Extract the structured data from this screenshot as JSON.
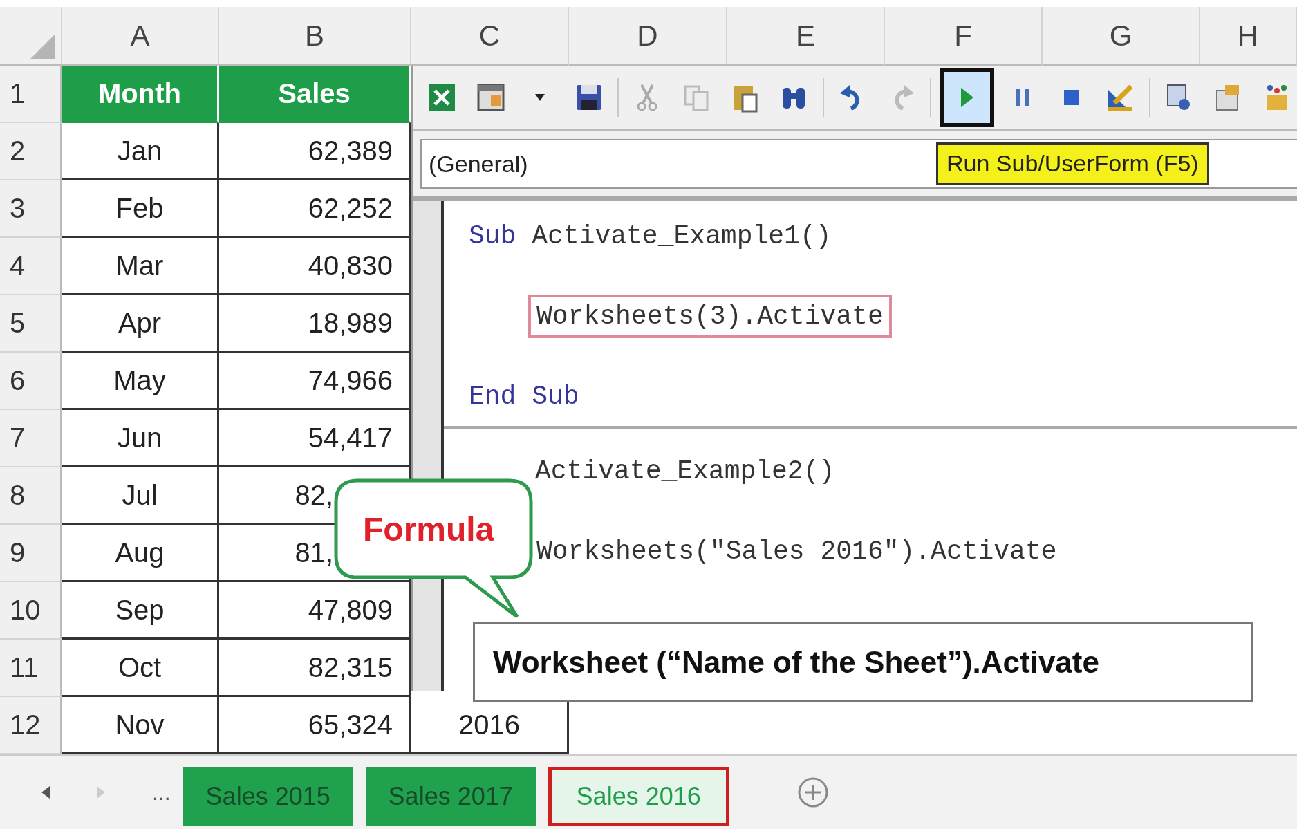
{
  "sheet": {
    "columns": [
      "A",
      "B",
      "C",
      "D",
      "E",
      "F",
      "G",
      "H"
    ],
    "rows": [
      {
        "header": "1",
        "kind": "heading",
        "cells": [
          {
            "text": "Month"
          },
          {
            "text": "Sales"
          }
        ]
      },
      {
        "header": "2",
        "kind": "data",
        "cells": [
          {
            "text": "Jan"
          },
          {
            "text": "62,389"
          }
        ]
      },
      {
        "header": "3",
        "kind": "data",
        "cells": [
          {
            "text": "Feb"
          },
          {
            "text": "62,252"
          }
        ]
      },
      {
        "header": "4",
        "kind": "data",
        "cells": [
          {
            "text": "Mar"
          },
          {
            "text": "40,830"
          }
        ]
      },
      {
        "header": "5",
        "kind": "data",
        "cells": [
          {
            "text": "Apr"
          },
          {
            "text": "18,989"
          }
        ]
      },
      {
        "header": "6",
        "kind": "data",
        "cells": [
          {
            "text": "May"
          },
          {
            "text": "74,966"
          }
        ]
      },
      {
        "header": "7",
        "kind": "data",
        "cells": [
          {
            "text": "Jun"
          },
          {
            "text": "54,417"
          }
        ]
      },
      {
        "header": "8",
        "kind": "data",
        "cells": [
          {
            "text": "Jul"
          },
          {
            "text": "82,",
            "cut": true
          }
        ]
      },
      {
        "header": "9",
        "kind": "data",
        "cells": [
          {
            "text": "Aug"
          },
          {
            "text": "81,",
            "cut": true
          }
        ]
      },
      {
        "header": "10",
        "kind": "data",
        "cells": [
          {
            "text": "Sep"
          },
          {
            "text": "47,809"
          }
        ]
      },
      {
        "header": "11",
        "kind": "data",
        "cells": [
          {
            "text": "Oct"
          },
          {
            "text": "82,315"
          }
        ]
      },
      {
        "header": "12",
        "kind": "data",
        "cells": [
          {
            "text": "Nov"
          },
          {
            "text": "65,324"
          },
          {
            "text": "2016"
          }
        ]
      }
    ],
    "tabs": [
      {
        "label": "Sales 2015",
        "selected": false
      },
      {
        "label": "Sales 2017",
        "selected": false
      },
      {
        "label": "Sales 2016",
        "selected": true
      }
    ],
    "tab_overflow": "..."
  },
  "vba_editor": {
    "toolbar": [
      {
        "kind": "excel",
        "selected": false
      },
      {
        "kind": "insert",
        "selected": false
      },
      {
        "kind": "caret",
        "selected": false
      },
      {
        "kind": "save",
        "selected": false
      },
      {
        "kind": "sep"
      },
      {
        "kind": "cut",
        "selected": false
      },
      {
        "kind": "copy",
        "selected": false
      },
      {
        "kind": "paste",
        "selected": false
      },
      {
        "kind": "find",
        "selected": false
      },
      {
        "kind": "sep"
      },
      {
        "kind": "undo",
        "selected": false
      },
      {
        "kind": "redo",
        "selected": false
      },
      {
        "kind": "sep"
      },
      {
        "kind": "run",
        "selected": true
      },
      {
        "kind": "pause",
        "selected": false
      },
      {
        "kind": "stop",
        "selected": false
      },
      {
        "kind": "design",
        "selected": false
      },
      {
        "kind": "sep"
      },
      {
        "kind": "project",
        "selected": false
      },
      {
        "kind": "properties",
        "selected": false
      },
      {
        "kind": "toolbox",
        "selected": false
      }
    ],
    "object_box": "(General)",
    "tooltip": "Run Sub/UserForm (F5)",
    "procedures": [
      {
        "lines": [
          {
            "kind": "head",
            "tokens": [
              {
                "kind": "keyword",
                "text": "Sub"
              },
              {
                "kind": "plain",
                "text": " Activate_Example1()"
              }
            ]
          },
          {
            "kind": "blank"
          },
          {
            "kind": "body",
            "boxed": true,
            "tokens": [
              {
                "kind": "plain",
                "text": "Worksheets(3).Activate"
              }
            ]
          },
          {
            "kind": "blank"
          },
          {
            "kind": "head",
            "tokens": [
              {
                "kind": "keyword",
                "text": "End Sub"
              }
            ]
          }
        ]
      },
      {
        "lines": [
          {
            "kind": "head_cut",
            "tokens": [
              {
                "kind": "plain",
                "text": "Activate_Example2()"
              }
            ]
          },
          {
            "kind": "blank"
          },
          {
            "kind": "body",
            "boxed": false,
            "tokens": [
              {
                "kind": "plain",
                "text": "Worksheets(\"Sales 2016\").Activate"
              }
            ]
          }
        ]
      }
    ]
  },
  "callout": "Formula",
  "syntax_box": "Worksheet (“Name of the Sheet”).Activate"
}
